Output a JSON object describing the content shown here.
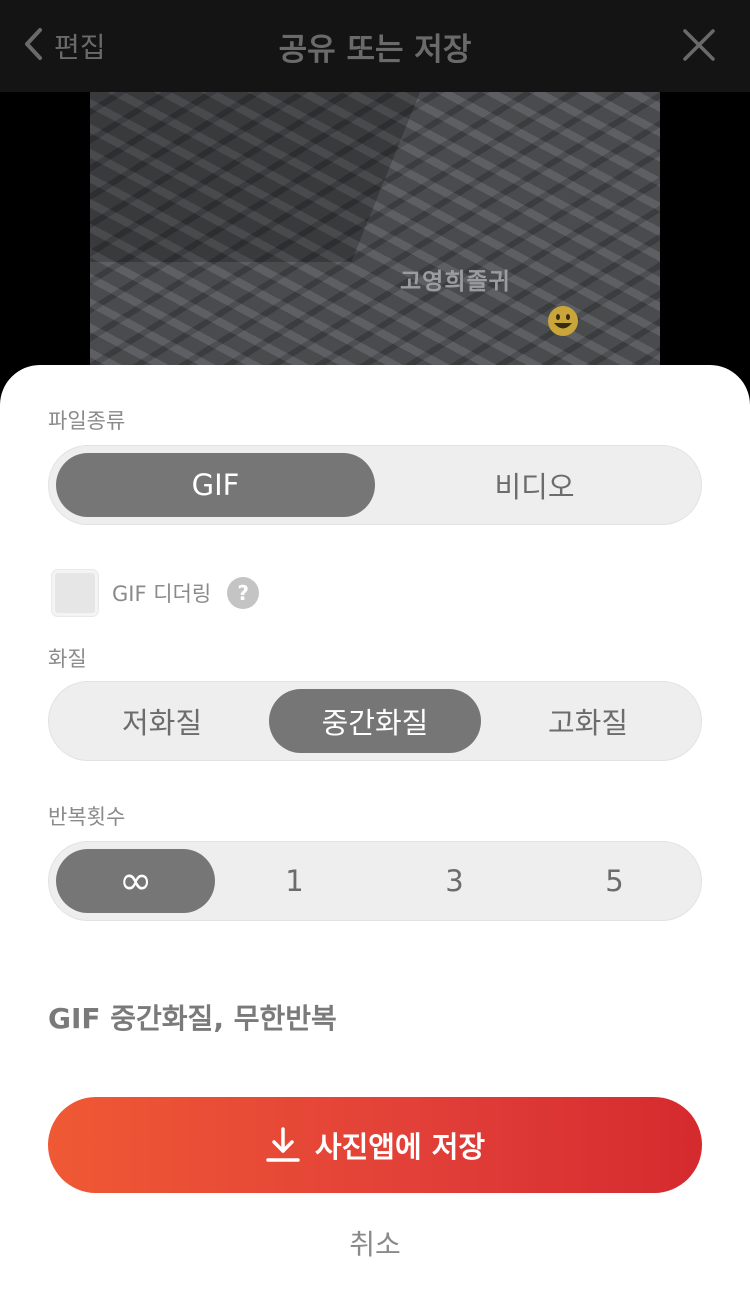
{
  "header": {
    "back_label": "편집",
    "title": "공유 또는 저장"
  },
  "preview": {
    "sticker_text": "고영희졸귀",
    "sticker_emoji": "smiling-face"
  },
  "sheet": {
    "file_type": {
      "label": "파일종류",
      "options": [
        "GIF",
        "비디오"
      ],
      "selected": "GIF"
    },
    "dither": {
      "label": "GIF 디더링",
      "checked": false,
      "help": "?"
    },
    "quality": {
      "label": "화질",
      "options": [
        "저화질",
        "중간화질",
        "고화질"
      ],
      "selected": "중간화질"
    },
    "repeat": {
      "label": "반복횟수",
      "options": [
        "∞",
        "1",
        "3",
        "5"
      ],
      "selected": "∞"
    },
    "summary": "GIF 중간화질, 무한반복",
    "save_label": "사진앱에 저장",
    "cancel_label": "취소"
  },
  "colors": {
    "accent_start": "#ef5934",
    "accent_end": "#d52a2e",
    "selected_segment": "#767676"
  }
}
